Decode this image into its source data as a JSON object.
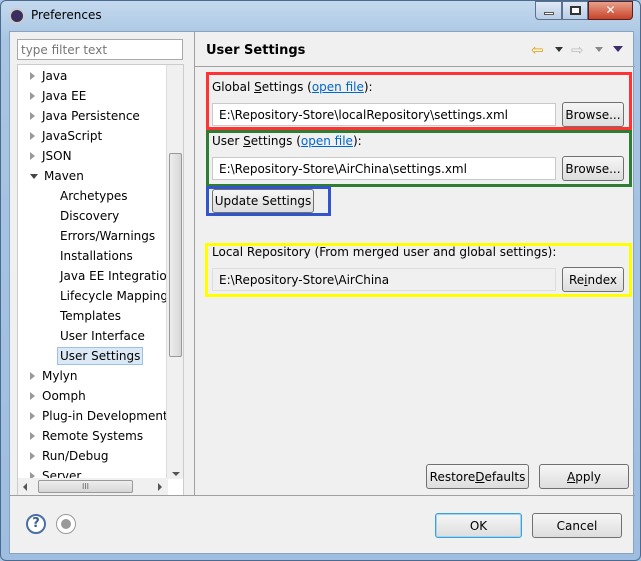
{
  "window": {
    "title": "Preferences",
    "icon": "eclipse-gear-icon",
    "controls": [
      "minimize",
      "maximize",
      "close"
    ]
  },
  "sidebar": {
    "filter_placeholder": "type filter text",
    "items": [
      {
        "label": "Java",
        "level": 0,
        "state": "collapsed"
      },
      {
        "label": "Java EE",
        "level": 0,
        "state": "collapsed"
      },
      {
        "label": "Java Persistence",
        "level": 0,
        "state": "collapsed"
      },
      {
        "label": "JavaScript",
        "level": 0,
        "state": "collapsed"
      },
      {
        "label": "JSON",
        "level": 0,
        "state": "collapsed"
      },
      {
        "label": "Maven",
        "level": 0,
        "state": "expanded"
      },
      {
        "label": "Archetypes",
        "level": 1
      },
      {
        "label": "Discovery",
        "level": 1
      },
      {
        "label": "Errors/Warnings",
        "level": 1
      },
      {
        "label": "Installations",
        "level": 1
      },
      {
        "label": "Java EE Integration",
        "level": 1
      },
      {
        "label": "Lifecycle Mapping",
        "level": 1
      },
      {
        "label": "Templates",
        "level": 1
      },
      {
        "label": "User Interface",
        "level": 1
      },
      {
        "label": "User Settings",
        "level": 1,
        "selected": true
      },
      {
        "label": "Mylyn",
        "level": 0,
        "state": "collapsed"
      },
      {
        "label": "Oomph",
        "level": 0,
        "state": "collapsed"
      },
      {
        "label": "Plug-in Development",
        "level": 0,
        "state": "collapsed"
      },
      {
        "label": "Remote Systems",
        "level": 0,
        "state": "collapsed"
      },
      {
        "label": "Run/Debug",
        "level": 0,
        "state": "collapsed"
      },
      {
        "label": "Server",
        "level": 0,
        "state": "collapsed"
      }
    ],
    "hscroll_thumb": "III"
  },
  "page": {
    "title": "User Settings",
    "nav_icons": [
      "back-arrow-icon",
      "back-menu-icon",
      "forward-arrow-icon",
      "forward-menu-icon",
      "view-menu-icon"
    ],
    "global": {
      "label_pre": "Global ",
      "label_u": "S",
      "label_post": "ettings (",
      "link": "open file",
      "label_end": "):",
      "value": "E:\\Repository-Store\\localRepository\\settings.xml",
      "browse": "Browse..."
    },
    "user": {
      "label_pre": "User ",
      "label_u": "S",
      "label_post": "ettings (",
      "link": "open file",
      "label_end": "):",
      "value": "E:\\Repository-Store\\AirChina\\settings.xml",
      "browse": "Browse..."
    },
    "update_button": "Update Settings",
    "local": {
      "label": "Local Repository (From merged user and global settings):",
      "value": "E:\\Repository-Store\\AirChina",
      "reindex_pre": "Re",
      "reindex_u": "i",
      "reindex_post": "ndex"
    },
    "restore_pre": "Restore ",
    "restore_u": "D",
    "restore_post": "efaults",
    "apply_u": "A",
    "apply_post": "pply"
  },
  "footer": {
    "ok": "OK",
    "cancel": "Cancel"
  },
  "annotation_colors": {
    "global": "#ff3333",
    "user": "#2e7d32",
    "update": "#3355cc",
    "local": "#ffff00"
  }
}
